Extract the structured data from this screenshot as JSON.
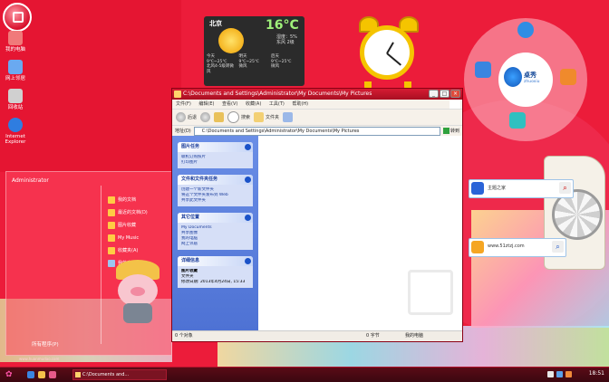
{
  "desktop": {
    "icons": [
      {
        "label": "我的电脑",
        "color": "#f07a7a"
      },
      {
        "label": "网上邻居",
        "color": "#6aa9f0"
      },
      {
        "label": "回收站",
        "color": "#d0d0d0"
      },
      {
        "label": "Internet Explorer",
        "color": "#2f7de0"
      }
    ]
  },
  "weather": {
    "city": "北京",
    "temperature": "16°C",
    "details": [
      "湿度：5%",
      "东风 2级"
    ],
    "days": [
      {
        "name": "今天",
        "range": "9℃~25℃",
        "desc": "北风4-5级转微风"
      },
      {
        "name": "明天",
        "range": "9℃~25℃",
        "desc": "微风"
      },
      {
        "name": "后天",
        "range": "9℃~25℃",
        "desc": "微风"
      }
    ]
  },
  "launcher": {
    "hub_label": "桌秀",
    "hub_sub": "zhuoxiu"
  },
  "search_widgets": [
    {
      "text": "主题之家",
      "icon_color": "#2a64d8"
    },
    {
      "text": "www.51ztzj.com",
      "icon_color": "#f5a623"
    }
  ],
  "explorer": {
    "title": "C:\\Documents and Settings\\Administrator\\My Documents\\My Pictures",
    "menu": [
      "文件(F)",
      "编辑(E)",
      "查看(V)",
      "收藏(A)",
      "工具(T)",
      "帮助(H)"
    ],
    "toolbar": {
      "back": "后退",
      "search": "搜索",
      "folders": "文件夹"
    },
    "address_label": "地址(D)",
    "address_value": "C:\\Documents and Settings\\Administrator\\My Documents\\My Pictures",
    "go_label": "转到",
    "panels": [
      {
        "title": "图片任务",
        "items": [
          "联机订购照片",
          "打印图片"
        ]
      },
      {
        "title": "文件和文件夹任务",
        "items": [
          "创建一个新文件夹",
          "将这个文件夹发布到 Web",
          "共享此文件夹"
        ]
      },
      {
        "title": "其它位置",
        "items": [
          "My Documents",
          "共享图像",
          "我的电脑",
          "网上邻居"
        ]
      }
    ],
    "details": {
      "title": "详细信息",
      "name": "图片收藏",
      "type": "文件夹",
      "modified": "修改日期: 2013年4月24日, 15:33"
    },
    "status": {
      "objects": "0 个对象",
      "size": "0 字节",
      "location": "我的电脑"
    }
  },
  "start_menu": {
    "user": "Administrator",
    "items": [
      "我的文档",
      "最近的文档(D)",
      "图片收藏",
      "My Music",
      "收藏夹(A)",
      "我的电脑"
    ],
    "all_programs": "所有程序(P)",
    "url": "www.huanmudao.com"
  },
  "taskbar": {
    "task_label": "C:\\Documents and...",
    "clock": "18:51"
  }
}
